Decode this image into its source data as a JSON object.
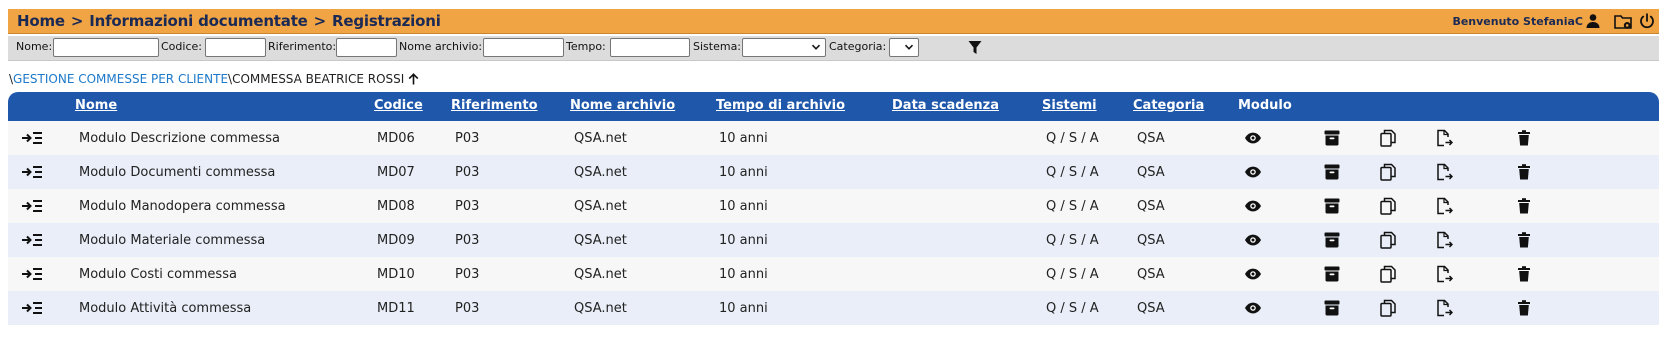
{
  "breadcrumb": {
    "items": [
      "Home",
      "Informazioni documentate",
      "Registrazioni"
    ],
    "separator": ">"
  },
  "header": {
    "welcome": "Benvenuto StefaniaC",
    "icons": [
      "user-icon",
      "folder-settings-icon",
      "power-icon"
    ],
    "color": "#f0a444"
  },
  "filters": {
    "nome_label": "Nome:",
    "nome_value": "",
    "codice_label": "Codice:",
    "codice_value": "",
    "riferimento_label": "Riferimento:",
    "riferimento_value": "",
    "nome_archivio_label": "Nome archivio:",
    "nome_archivio_value": "",
    "tempo_label": "Tempo:",
    "tempo_value": "",
    "sistema_label": "Sistema:",
    "sistema_value": "",
    "categoria_label": "Categoria:",
    "categoria_value": ""
  },
  "path": {
    "root": "\\",
    "link": "GESTIONE COMMESSE PER CLIENTE",
    "sep": "\\",
    "current": "COMMESSA BEATRICE ROSSI"
  },
  "table": {
    "header_color": "#1f57aa",
    "columns": {
      "nome": "Nome",
      "codice": "Codice",
      "riferimento": "Riferimento",
      "nome_archivio": "Nome archivio",
      "tempo": "Tempo di archivio",
      "scadenza": "Data scadenza",
      "sistemi": "Sistemi",
      "categoria": "Categoria",
      "modulo": "Modulo"
    },
    "rows": [
      {
        "nome": "Modulo Descrizione commessa",
        "codice": "MD06",
        "riferimento": "P03",
        "archivio": "QSA.net",
        "tempo": "10 anni",
        "scadenza": "",
        "sistemi": "Q / S / A",
        "categoria": "QSA"
      },
      {
        "nome": "Modulo Documenti commessa",
        "codice": "MD07",
        "riferimento": "P03",
        "archivio": "QSA.net",
        "tempo": "10 anni",
        "scadenza": "",
        "sistemi": "Q / S / A",
        "categoria": "QSA"
      },
      {
        "nome": "Modulo Manodopera commessa",
        "codice": "MD08",
        "riferimento": "P03",
        "archivio": "QSA.net",
        "tempo": "10 anni",
        "scadenza": "",
        "sistemi": "Q / S / A",
        "categoria": "QSA"
      },
      {
        "nome": "Modulo Materiale commessa",
        "codice": "MD09",
        "riferimento": "P03",
        "archivio": "QSA.net",
        "tempo": "10 anni",
        "scadenza": "",
        "sistemi": "Q / S / A",
        "categoria": "QSA"
      },
      {
        "nome": "Modulo Costi commessa",
        "codice": "MD10",
        "riferimento": "P03",
        "archivio": "QSA.net",
        "tempo": "10 anni",
        "scadenza": "",
        "sistemi": "Q / S / A",
        "categoria": "QSA"
      },
      {
        "nome": "Modulo Attività commessa",
        "codice": "MD11",
        "riferimento": "P03",
        "archivio": "QSA.net",
        "tempo": "10 anni",
        "scadenza": "",
        "sistemi": "Q / S / A",
        "categoria": "QSA"
      }
    ],
    "row_icons": [
      "indent-icon",
      "eye-icon",
      "archive-icon",
      "copy-icon",
      "file-export-icon",
      "trash-icon"
    ]
  }
}
